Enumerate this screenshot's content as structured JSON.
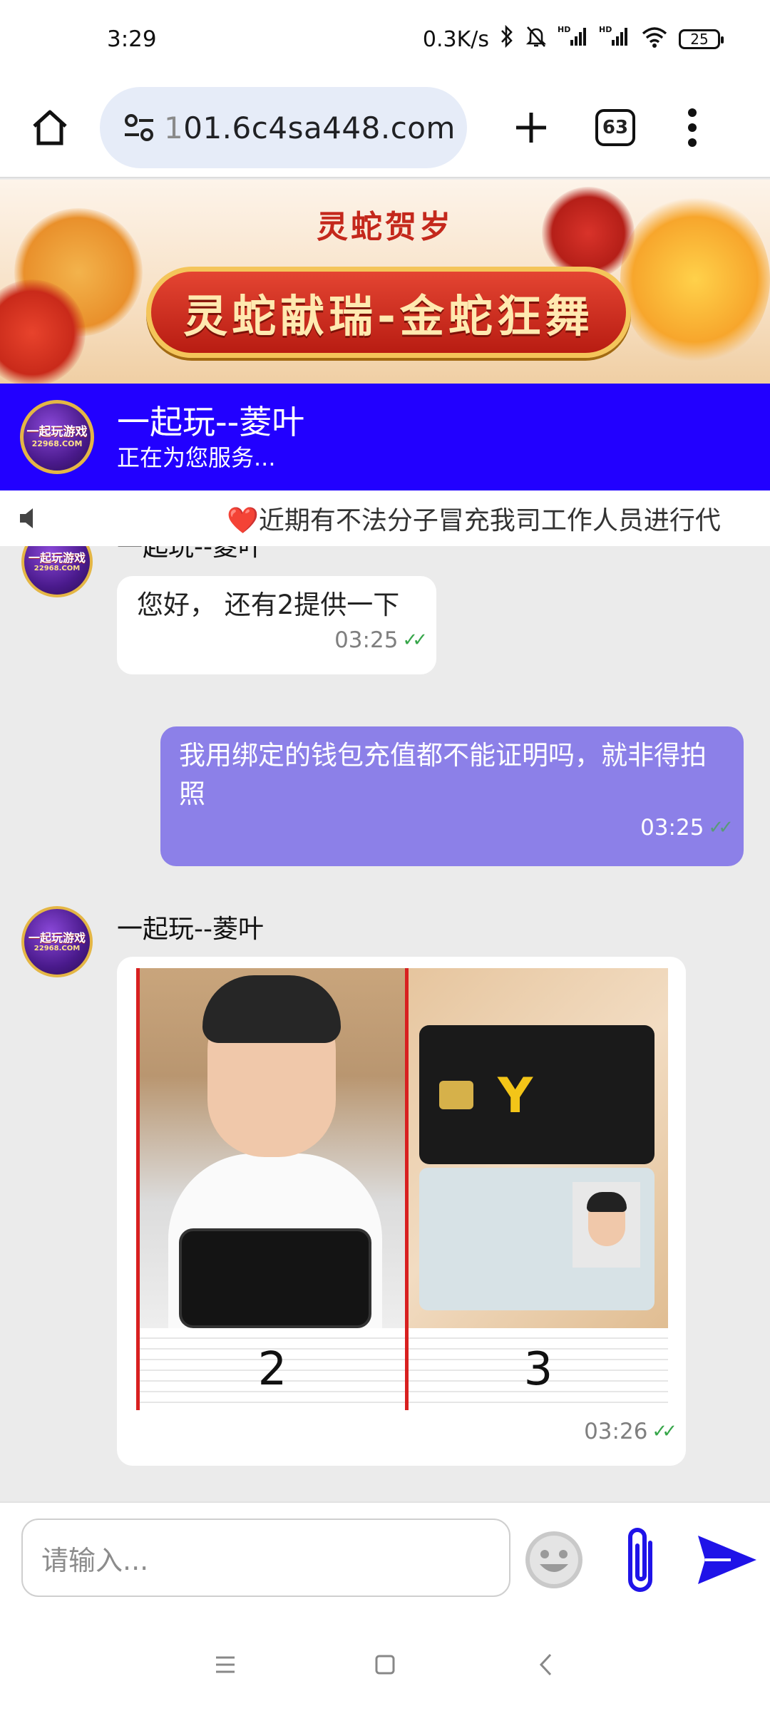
{
  "status_bar": {
    "time": "3:29",
    "net_speed": "0.3K/s",
    "battery": "25"
  },
  "browser": {
    "url_prefix": "1",
    "url_rest": "01.6c4sa448.com",
    "tab_count": "63"
  },
  "banner": {
    "subtitle": "灵蛇贺岁",
    "title": "灵蛇献瑞-金蛇狂舞"
  },
  "service": {
    "logo_line1": "一起玩游戏",
    "logo_line2": "22968.COM",
    "name": "一起玩--菱叶",
    "status": "正在为您服务..."
  },
  "notice": {
    "text": "❤️近期有不法分子冒充我司工作人员进行代"
  },
  "messages": [
    {
      "direction": "in",
      "sender": "一起玩--菱叶",
      "text": "您好， 还有2提供一下",
      "time": "03:25"
    },
    {
      "direction": "out",
      "text": "我用绑定的钱包充值都不能证明吗，就非得拍照",
      "time": "03:25"
    },
    {
      "direction": "in",
      "sender": "一起玩--菱叶",
      "image_labels": [
        "2",
        "3"
      ],
      "time": "03:26"
    }
  ],
  "input": {
    "placeholder": "请输入..."
  },
  "colors": {
    "header_blue": "#2200ff",
    "outgoing_bubble": "#8c80e8",
    "send_blue": "#1f13e8"
  }
}
